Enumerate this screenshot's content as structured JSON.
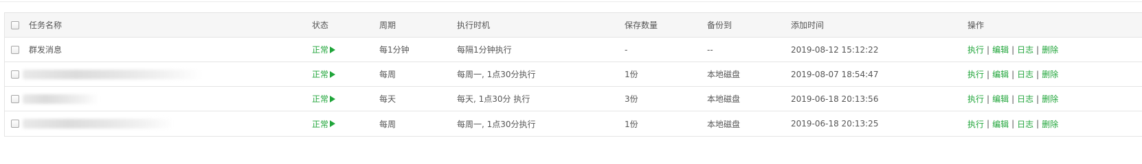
{
  "headers": {
    "name": "任务名称",
    "status": "状态",
    "period": "周期",
    "exec_time": "执行时机",
    "keep_count": "保存数量",
    "backup_to": "备份到",
    "added_time": "添加时间",
    "ops": "操作"
  },
  "ops_labels": {
    "run": "执行",
    "edit": "编辑",
    "log": "日志",
    "delete": "删除",
    "separator": "|"
  },
  "rows": [
    {
      "name": "群发消息",
      "status": "正常",
      "period": "每1分钟",
      "exec_time": "每隔1分钟执行",
      "keep_count": "-",
      "backup_to": "--",
      "added_time": "2019-08-12 15:12:22"
    },
    {
      "name": "",
      "status": "正常",
      "period": "每周",
      "exec_time": "每周一, 1点30分执行",
      "keep_count": "1份",
      "backup_to": "本地磁盘",
      "added_time": "2019-08-07 18:54:47"
    },
    {
      "name": "",
      "status": "正常",
      "period": "每天",
      "exec_time": "每天, 1点30分 执行",
      "keep_count": "3份",
      "backup_to": "本地磁盘",
      "added_time": "2019-06-18 20:13:56"
    },
    {
      "name": "",
      "status": "正常",
      "period": "每周",
      "exec_time": "每周一, 1点30分执行",
      "keep_count": "1份",
      "backup_to": "本地磁盘",
      "added_time": "2019-06-18 20:13:25"
    }
  ],
  "colors": {
    "accent_green": "#20a53a",
    "header_bg": "#f6f6f6",
    "border": "#e4e4e4"
  }
}
